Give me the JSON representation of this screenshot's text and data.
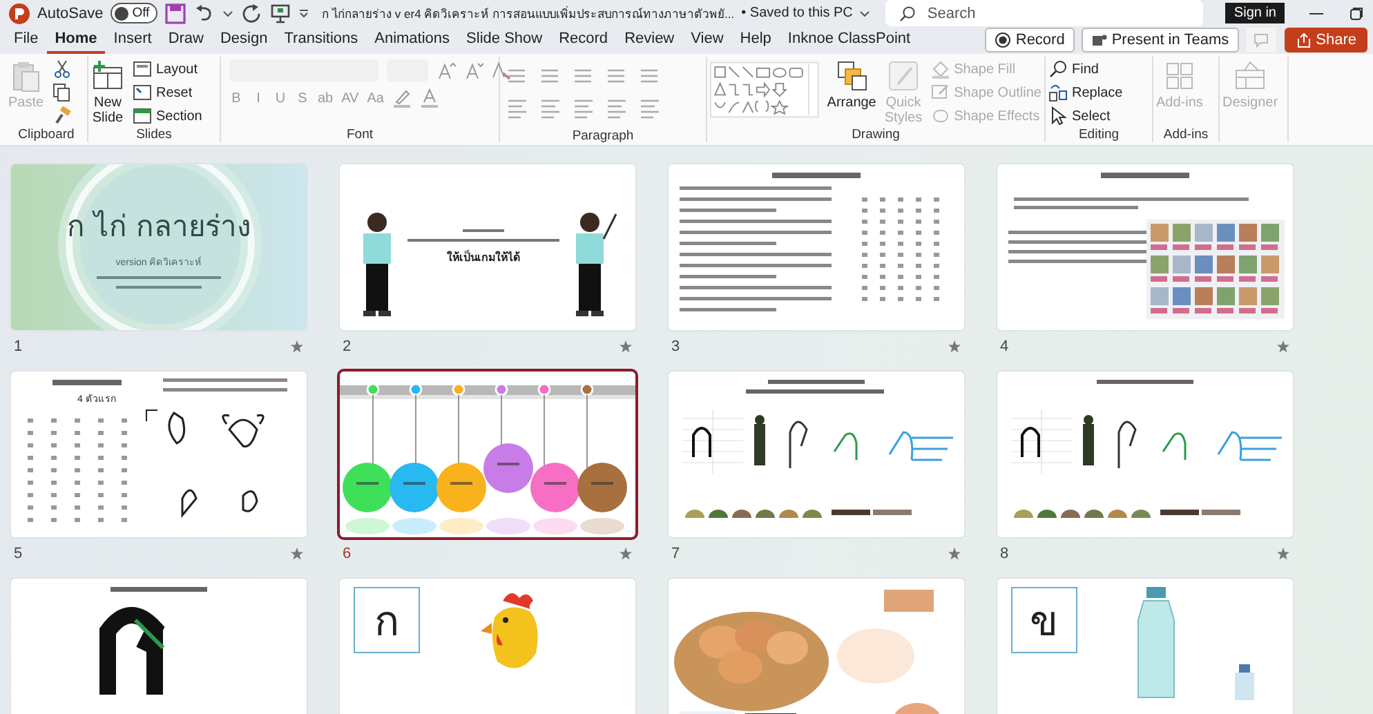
{
  "title_bar": {
    "autosave_label": "AutoSave",
    "autosave": {
      "label": "Off",
      "on": false
    },
    "document_title": "ก ไก่กลายร่าง v er4 คิดวิเคราะห์ การสอนแบบเพิ่มประสบการณ์ทางภาษาตัวพยั...",
    "save_status": "• Saved to this PC",
    "search_placeholder": "Search",
    "sign_in": "Sign in"
  },
  "tabs": [
    {
      "label": "File",
      "selected": false
    },
    {
      "label": "Home",
      "selected": true
    },
    {
      "label": "Insert",
      "selected": false
    },
    {
      "label": "Draw",
      "selected": false
    },
    {
      "label": "Design",
      "selected": false
    },
    {
      "label": "Transitions",
      "selected": false
    },
    {
      "label": "Animations",
      "selected": false
    },
    {
      "label": "Slide Show",
      "selected": false
    },
    {
      "label": "Record",
      "selected": false
    },
    {
      "label": "Review",
      "selected": false
    },
    {
      "label": "View",
      "selected": false
    },
    {
      "label": "Help",
      "selected": false
    },
    {
      "label": "Inknoe ClassPoint",
      "selected": false
    }
  ],
  "tab_actions": {
    "record": "Record",
    "present": "Present in Teams",
    "share": "Share"
  },
  "ribbon": {
    "clipboard": {
      "label": "Clipboard",
      "paste": {
        "label": "Paste",
        "disabled": true
      }
    },
    "slides": {
      "label": "Slides",
      "new_slide": [
        "New",
        "Slide"
      ],
      "layout": "Layout",
      "reset": "Reset",
      "section": "Section"
    },
    "font": {
      "label": "Font",
      "buttons": [
        "B",
        "I",
        "U",
        "S",
        "ab",
        "AV",
        "Aa"
      ]
    },
    "paragraph": {
      "label": "Paragraph"
    },
    "drawing": {
      "label": "Drawing",
      "arrange": "Arrange",
      "quick_styles": [
        "Quick",
        "Styles"
      ],
      "shape_fill": "Shape Fill",
      "shape_outline": "Shape Outline",
      "shape_effects": "Shape Effects"
    },
    "editing": {
      "label": "Editing",
      "find": "Find",
      "replace": "Replace",
      "select": "Select"
    },
    "addins": {
      "label": "Add-ins",
      "button": "Add-ins"
    },
    "designer": {
      "button": "Designer"
    }
  },
  "slides": [
    {
      "number": "1",
      "selected": false,
      "animated": true,
      "kind": "cover",
      "texts": [
        "ก ไก่ กลายร่าง",
        "version คิดวิเคราะห์"
      ]
    },
    {
      "number": "2",
      "selected": false,
      "animated": true,
      "kind": "teachers",
      "texts": [
        "ให้เป็นเกมให้ได้"
      ]
    },
    {
      "number": "3",
      "selected": false,
      "animated": true,
      "kind": "text-table"
    },
    {
      "number": "4",
      "selected": false,
      "animated": true,
      "kind": "text-cards"
    },
    {
      "number": "5",
      "selected": false,
      "animated": true,
      "kind": "table-sketches",
      "texts": [
        "4 ตัวแรก"
      ]
    },
    {
      "number": "6",
      "selected": true,
      "animated": true,
      "kind": "steps"
    },
    {
      "number": "7",
      "selected": false,
      "animated": true,
      "kind": "soldiers"
    },
    {
      "number": "8",
      "selected": false,
      "animated": true,
      "kind": "soldiers-scattered"
    },
    {
      "kind": "big-letter"
    },
    {
      "kind": "letter-rooster",
      "texts": [
        "ก"
      ]
    },
    {
      "kind": "eggs"
    },
    {
      "kind": "letter-bottle",
      "texts": [
        "ข"
      ]
    }
  ]
}
